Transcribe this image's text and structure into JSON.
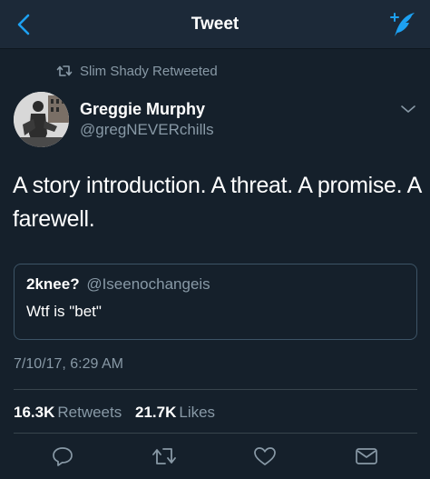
{
  "navbar": {
    "title": "Tweet"
  },
  "retweet_context": {
    "text": "Slim Shady Retweeted"
  },
  "author": {
    "name": "Greggie Murphy",
    "handle": "@gregNEVERchills"
  },
  "tweet": {
    "text": "A story introduction. A threat. A promise. A farewell."
  },
  "quoted_tweet": {
    "name": "2knee?",
    "handle": "@Iseenochangeis",
    "text": "Wtf is \"bet\""
  },
  "timestamp": "7/10/17, 6:29 AM",
  "stats": {
    "retweets_count": "16.3K",
    "retweets_label": "Retweets",
    "likes_count": "21.7K",
    "likes_label": "Likes"
  },
  "colors": {
    "background": "#15202b",
    "navbar": "#1c2938",
    "accent": "#1da1f2",
    "secondary_text": "#8899a6",
    "border": "#38444d"
  },
  "icons": [
    "back-chevron-icon",
    "compose-tweet-icon",
    "retweet-icon",
    "caret-down-icon",
    "reply-icon",
    "retweet-icon",
    "like-icon",
    "direct-message-icon"
  ]
}
